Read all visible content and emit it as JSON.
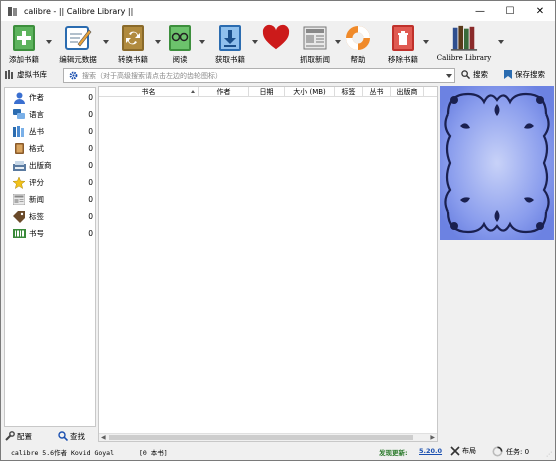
{
  "window": {
    "title": "calibre - || Calibre Library ||",
    "controls": [
      "—",
      "☐",
      "✕"
    ]
  },
  "toolbar": {
    "items": [
      {
        "label": "添加书籍",
        "icon": "add-book-icon"
      },
      {
        "label": "编辑元数据",
        "icon": "edit-metadata-icon"
      },
      {
        "label": "转换书籍",
        "icon": "convert-book-icon"
      },
      {
        "label": "阅读",
        "icon": "read-book-icon"
      },
      {
        "label": "获取书籍",
        "icon": "get-books-icon"
      },
      {
        "label": "",
        "icon": "heart-donate-icon"
      },
      {
        "label": "抓取新闻",
        "icon": "fetch-news-icon"
      },
      {
        "label": "帮助",
        "icon": "help-lifebuoy-icon"
      },
      {
        "label": "移除书籍",
        "icon": "remove-book-icon"
      },
      {
        "label": "Calibre Library",
        "icon": "library-books-icon"
      }
    ]
  },
  "searchbar": {
    "virtual_library": "虚拟书库",
    "placeholder": "搜索（对于高级搜索请点击左边的齿轮图标）",
    "search_label": "搜索",
    "saved_search_label": "保存搜索"
  },
  "tag_browser": {
    "categories": [
      {
        "label": "作者",
        "count": "0",
        "icon": "person-icon"
      },
      {
        "label": "语言",
        "count": "0",
        "icon": "language-icon"
      },
      {
        "label": "丛书",
        "count": "0",
        "icon": "series-icon"
      },
      {
        "label": "格式",
        "count": "0",
        "icon": "format-icon"
      },
      {
        "label": "出版商",
        "count": "0",
        "icon": "publisher-icon"
      },
      {
        "label": "评分",
        "count": "0",
        "icon": "star-rating-icon"
      },
      {
        "label": "新闻",
        "count": "0",
        "icon": "news-icon"
      },
      {
        "label": "标签",
        "count": "0",
        "icon": "tag-icon"
      },
      {
        "label": "书号",
        "count": "0",
        "icon": "identifier-barcode-icon"
      }
    ],
    "configure_label": "配置",
    "find_label": "查找"
  },
  "book_table": {
    "columns": [
      "书名",
      "作者",
      "日期",
      "大小 (MB)",
      "标签",
      "丛书",
      "出版商"
    ]
  },
  "statusbar": {
    "version": "calibre 5.6作者 Kovid Goyal",
    "book_count": "[0 本书]",
    "update_label": "发现更新:",
    "update_version": "5.20.0",
    "layout_label": "布局",
    "jobs_label": "任务: 0"
  },
  "colors": {
    "accent": "#1a4fb0",
    "cover_bg": "#7e93ea",
    "update_green": "#2a7a2a"
  }
}
